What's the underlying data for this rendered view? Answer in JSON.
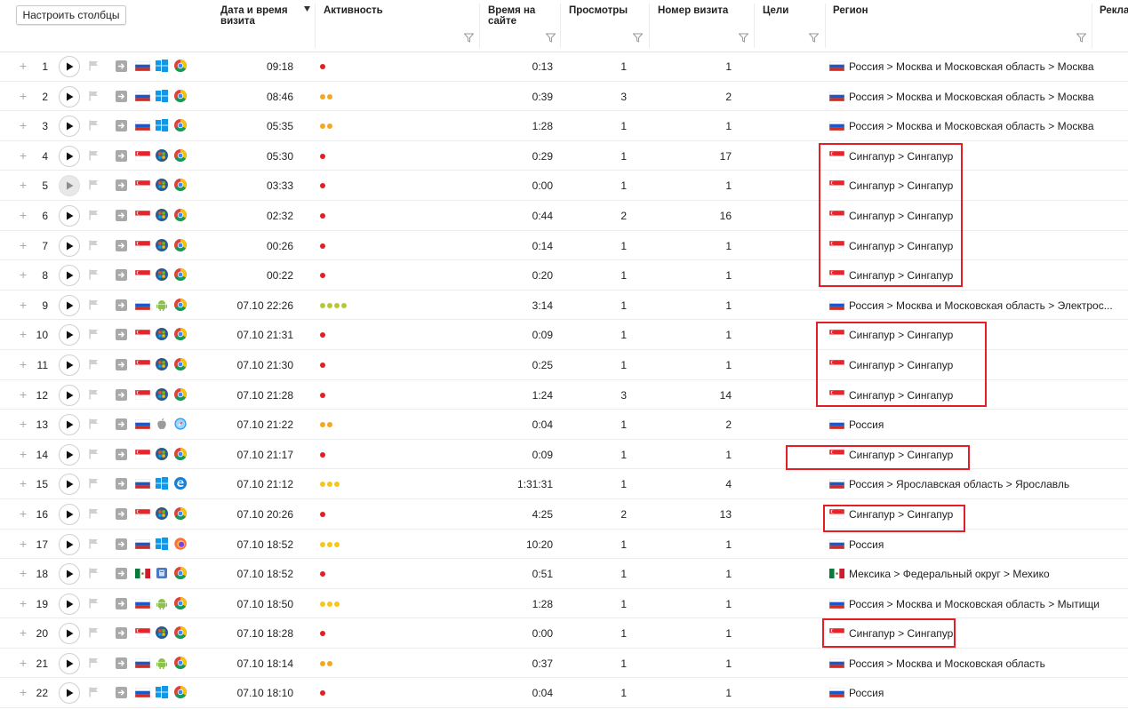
{
  "toolbar": {
    "configure_columns_label": "Настроить столбцы"
  },
  "columns": {
    "datetime": "Дата и время визита",
    "activity": "Активность",
    "time_on_site": "Время на сайте",
    "views": "Просмотры",
    "visit_number": "Номер визита",
    "goals": "Цели",
    "region": "Регион",
    "ads": "Рекла"
  },
  "colors": {
    "activity_red": "#e41e25",
    "activity_orange": "#f5a623",
    "activity_yellow": "#f7c61d",
    "activity_green": "#b7c93a",
    "highlight": "#e41e25"
  },
  "rows": [
    {
      "n": "1",
      "time": "09:18",
      "act": "red1",
      "dur": "0:13",
      "views": "1",
      "visit": "1",
      "country": "ru",
      "os": "windows",
      "browser": "chrome",
      "region": "Россия > Москва и Московская область > Москва"
    },
    {
      "n": "2",
      "time": "08:46",
      "act": "orange2",
      "dur": "0:39",
      "views": "3",
      "visit": "2",
      "country": "ru",
      "os": "windows",
      "browser": "chrome",
      "region": "Россия > Москва и Московская область > Москва"
    },
    {
      "n": "3",
      "time": "05:35",
      "act": "orange2",
      "dur": "1:28",
      "views": "1",
      "visit": "1",
      "country": "ru",
      "os": "windows",
      "browser": "chrome",
      "region": "Россия > Москва и Московская область > Москва"
    },
    {
      "n": "4",
      "time": "05:30",
      "act": "red1",
      "dur": "0:29",
      "views": "1",
      "visit": "17",
      "country": "sg",
      "os": "windows7",
      "browser": "chrome",
      "region": "Сингапур > Сингапур"
    },
    {
      "n": "5",
      "time": "03:33",
      "act": "red1",
      "dur": "0:00",
      "views": "1",
      "visit": "1",
      "country": "sg",
      "os": "windows7",
      "browser": "chrome",
      "region": "Сингапур > Сингапур",
      "muted": true
    },
    {
      "n": "6",
      "time": "02:32",
      "act": "red1",
      "dur": "0:44",
      "views": "2",
      "visit": "16",
      "country": "sg",
      "os": "windows7",
      "browser": "chrome",
      "region": "Сингапур > Сингапур"
    },
    {
      "n": "7",
      "time": "00:26",
      "act": "red1",
      "dur": "0:14",
      "views": "1",
      "visit": "1",
      "country": "sg",
      "os": "windows7",
      "browser": "chrome",
      "region": "Сингапур > Сингапур"
    },
    {
      "n": "8",
      "time": "00:22",
      "act": "red1",
      "dur": "0:20",
      "views": "1",
      "visit": "1",
      "country": "sg",
      "os": "windows7",
      "browser": "chrome",
      "region": "Сингапур > Сингапур"
    },
    {
      "n": "9",
      "time": "07.10 22:26",
      "act": "green4",
      "dur": "3:14",
      "views": "1",
      "visit": "1",
      "country": "ru",
      "os": "android",
      "browser": "chrome",
      "region": "Россия > Москва и Московская область > Электрос..."
    },
    {
      "n": "10",
      "time": "07.10 21:31",
      "act": "red1",
      "dur": "0:09",
      "views": "1",
      "visit": "1",
      "country": "sg",
      "os": "windows7",
      "browser": "chrome",
      "region": "Сингапур > Сингапур"
    },
    {
      "n": "11",
      "time": "07.10 21:30",
      "act": "red1",
      "dur": "0:25",
      "views": "1",
      "visit": "1",
      "country": "sg",
      "os": "windows7",
      "browser": "chrome",
      "region": "Сингапур > Сингапур"
    },
    {
      "n": "12",
      "time": "07.10 21:28",
      "act": "red1",
      "dur": "1:24",
      "views": "3",
      "visit": "14",
      "country": "sg",
      "os": "windows7",
      "browser": "chrome",
      "region": "Сингапур > Сингапур"
    },
    {
      "n": "13",
      "time": "07.10 21:22",
      "act": "orange2",
      "dur": "0:04",
      "views": "1",
      "visit": "2",
      "country": "ru",
      "os": "apple",
      "browser": "safari",
      "region": "Россия"
    },
    {
      "n": "14",
      "time": "07.10 21:17",
      "act": "red1",
      "dur": "0:09",
      "views": "1",
      "visit": "1",
      "country": "sg",
      "os": "windows7",
      "browser": "chrome",
      "region": "Сингапур > Сингапур"
    },
    {
      "n": "15",
      "time": "07.10 21:12",
      "act": "yellow3",
      "dur": "1:31:31",
      "views": "1",
      "visit": "4",
      "country": "ru",
      "os": "windows",
      "browser": "edge",
      "region": "Россия > Ярославская область > Ярославль"
    },
    {
      "n": "16",
      "time": "07.10 20:26",
      "act": "red1",
      "dur": "4:25",
      "views": "2",
      "visit": "13",
      "country": "sg",
      "os": "windows7",
      "browser": "chrome",
      "region": "Сингапур > Сингапур"
    },
    {
      "n": "17",
      "time": "07.10 18:52",
      "act": "yellow3",
      "dur": "10:20",
      "views": "1",
      "visit": "1",
      "country": "ru",
      "os": "windows",
      "browser": "firefox",
      "region": "Россия"
    },
    {
      "n": "18",
      "time": "07.10 18:52",
      "act": "red1",
      "dur": "0:51",
      "views": "1",
      "visit": "1",
      "country": "mx",
      "os": "mac",
      "browser": "chrome",
      "region": "Мексика > Федеральный округ > Мехико"
    },
    {
      "n": "19",
      "time": "07.10 18:50",
      "act": "yellow3",
      "dur": "1:28",
      "views": "1",
      "visit": "1",
      "country": "ru",
      "os": "android",
      "browser": "chrome",
      "region": "Россия > Москва и Московская область > Мытищи"
    },
    {
      "n": "20",
      "time": "07.10 18:28",
      "act": "red1",
      "dur": "0:00",
      "views": "1",
      "visit": "1",
      "country": "sg",
      "os": "windows7",
      "browser": "chrome",
      "region": "Сингапур > Сингапур"
    },
    {
      "n": "21",
      "time": "07.10 18:14",
      "act": "orange2",
      "dur": "0:37",
      "views": "1",
      "visit": "1",
      "country": "ru",
      "os": "android",
      "browser": "chrome",
      "region": "Россия > Москва и Московская область"
    },
    {
      "n": "22",
      "time": "07.10 18:10",
      "act": "red1",
      "dur": "0:04",
      "views": "1",
      "visit": "1",
      "country": "ru",
      "os": "windows",
      "browser": "chrome",
      "region": "Россия"
    }
  ]
}
